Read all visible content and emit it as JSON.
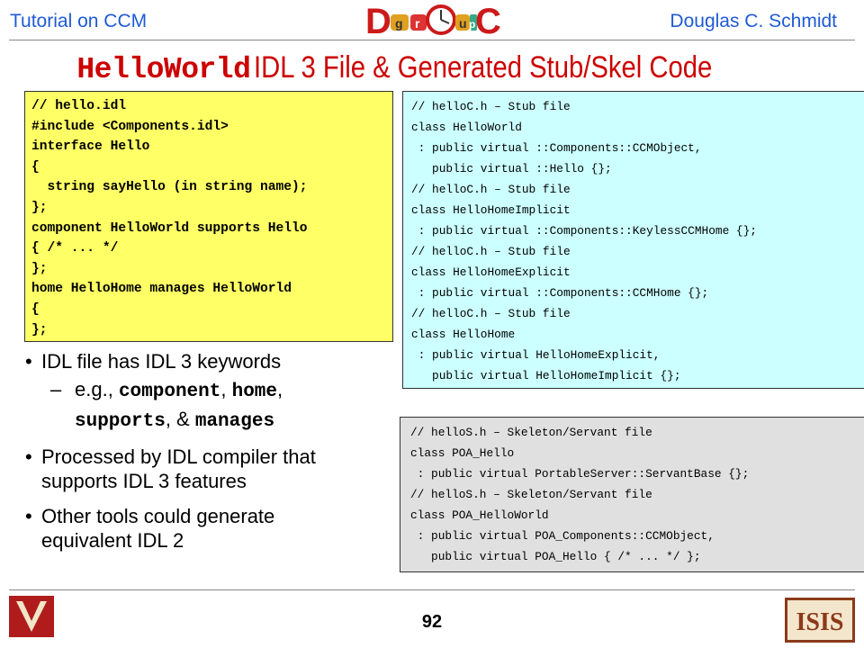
{
  "header": {
    "left": "Tutorial on CCM",
    "right": "Douglas C. Schmidt",
    "logo_letters": [
      "D",
      "g",
      "r",
      "u",
      "p",
      "C"
    ]
  },
  "title": {
    "code": "HelloWorld",
    "rest": "IDL 3 File & Generated Stub/Skel Code"
  },
  "idl_box": {
    "lines": [
      "// hello.idl",
      "#include <Components.idl>",
      "interface Hello",
      "{",
      "  string sayHello (in string name);",
      "};",
      "component HelloWorld supports Hello",
      "{ /* ... */",
      "};",
      "home HelloHome manages HelloWorld",
      "{",
      "};"
    ]
  },
  "stub_box": {
    "lines": [
      "// helloC.h – Stub file",
      "class HelloWorld",
      " : public virtual ::Components::CCMObject,",
      "   public virtual ::Hello {};",
      "// helloC.h – Stub file",
      "class HelloHomeImplicit",
      " : public virtual ::Components::KeylessCCMHome {};",
      "// helloC.h – Stub file",
      "class HelloHomeExplicit",
      " : public virtual ::Components::CCMHome {};",
      "// helloC.h – Stub file",
      "class HelloHome",
      " : public virtual HelloHomeExplicit,",
      "   public virtual HelloHomeImplicit {};"
    ]
  },
  "skel_box": {
    "lines": [
      "// helloS.h – Skeleton/Servant file",
      "class POA_Hello",
      " : public virtual PortableServer::ServantBase {};",
      "// helloS.h – Skeleton/Servant file",
      "class POA_HelloWorld",
      " : public virtual POA_Components::CCMObject,",
      "   public virtual POA_Hello { /* ... */ };"
    ]
  },
  "bullets": {
    "b1": "IDL file has IDL 3 keywords",
    "sub": {
      "eg": "e.g.",
      "k1": "component",
      "k2": "home",
      "k3": "supports",
      "k4": "manages",
      "sep1": ", ",
      "sep2": ", ",
      "sep3": ", & "
    },
    "b2_l1": "Processed by IDL compiler that",
    "b2_l2": "supports IDL 3 features",
    "b3_l1": "Other tools could generate",
    "b3_l2": "equivalent IDL 2"
  },
  "footer": {
    "page": "92",
    "right_logo_text": "ISIS"
  },
  "colors": {
    "header_text": "#1f5bd6",
    "title": "#cc0000",
    "idl_bg": "#ffff66",
    "stub_bg": "#ccffff",
    "skel_bg": "#e0e0e0",
    "vu_red": "#b01c1c",
    "isis_brown": "#8b3a1a"
  }
}
